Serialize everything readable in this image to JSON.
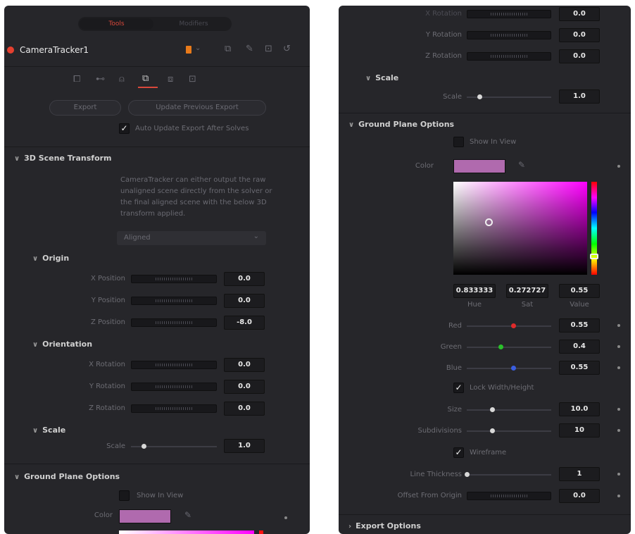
{
  "left": {
    "tabs": [
      "Tools",
      "Modifiers"
    ],
    "node_name": "CameraTracker1",
    "buttons": {
      "export": "Export",
      "update_previous": "Update Previous Export"
    },
    "auto_update_label": "Auto Update Export After Solves",
    "auto_update_checked": true,
    "scene_transform": {
      "header": "3D Scene Transform",
      "description_lines": [
        "CameraTracker can either output the raw",
        "unaligned scene directly from the solver or",
        "the final aligned scene with the below 3D",
        "transform applied."
      ],
      "mode_value": "Aligned",
      "origin": {
        "header": "Origin",
        "rows": [
          {
            "label": "X Position",
            "value": "0.0"
          },
          {
            "label": "Y Position",
            "value": "0.0"
          },
          {
            "label": "Z Position",
            "value": "-8.0"
          }
        ]
      },
      "orientation": {
        "header": "Orientation",
        "rows": [
          {
            "label": "X Rotation",
            "value": "0.0"
          },
          {
            "label": "Y Rotation",
            "value": "0.0"
          },
          {
            "label": "Z Rotation",
            "value": "0.0"
          }
        ]
      },
      "scale": {
        "header": "Scale",
        "label": "Scale",
        "value": "1.0",
        "level": 0.15
      }
    },
    "ground_plane": {
      "header": "Ground Plane Options",
      "show_in_view": "Show In View",
      "color_label": "Color"
    }
  },
  "right": {
    "rotation_rows": [
      {
        "label": "X Rotation",
        "value": "0.0"
      },
      {
        "label": "Y Rotation",
        "value": "0.0"
      },
      {
        "label": "Z Rotation",
        "value": "0.0"
      }
    ],
    "scale": {
      "header": "Scale",
      "label": "Scale",
      "value": "1.0",
      "level": 0.15
    },
    "ground_plane": {
      "header": "Ground Plane Options",
      "show_in_view": "Show In View",
      "color_label": "Color",
      "color_hex": "#b06aae",
      "hsv": {
        "hue": "0.833333",
        "sat": "0.272727",
        "value": "0.55",
        "hue_label": "Hue",
        "sat_label": "Sat",
        "value_label": "Value"
      },
      "sliders": [
        {
          "label": "Red",
          "value": "0.55",
          "level": 0.55,
          "knob_color": "#e02a2a"
        },
        {
          "label": "Green",
          "value": "0.4",
          "level": 0.4,
          "knob_color": "#2ac02a"
        },
        {
          "label": "Blue",
          "value": "0.55",
          "level": 0.55,
          "knob_color": "#3a5ee0"
        }
      ],
      "lock_label": "Lock Width/Height",
      "lock_checked": true,
      "size": {
        "label": "Size",
        "value": "10.0",
        "level": 0.3
      },
      "subdivisions": {
        "label": "Subdivisions",
        "value": "10",
        "level": 0.3
      },
      "wireframe_label": "Wireframe",
      "wireframe_checked": true,
      "line_thickness": {
        "label": "Line Thickness",
        "value": "1",
        "level": 0.0
      },
      "offset": {
        "label": "Offset From Origin",
        "value": "0.0"
      }
    },
    "export_options": "Export Options"
  }
}
